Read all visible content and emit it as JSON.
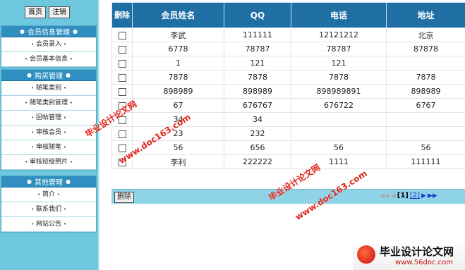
{
  "sidebar": {
    "top_buttons": [
      "首页",
      "注销"
    ],
    "sections": [
      {
        "title": "会员信息管理",
        "items": [
          "会员录入",
          "会员基本信息"
        ]
      },
      {
        "title": "购买管理",
        "items": [
          "随笔类别",
          "随笔类别管理",
          "回帖管理",
          "审核会员",
          "审核随笔",
          "审核班级照片"
        ]
      },
      {
        "title": "其他管理",
        "items": [
          "简介",
          "联系我们",
          "网站公告"
        ]
      }
    ]
  },
  "table": {
    "headers": [
      "删除",
      "会员姓名",
      "QQ",
      "电话",
      "地址"
    ],
    "rows": [
      [
        "李武",
        "111111",
        "12121212",
        "北京"
      ],
      [
        "6778",
        "78787",
        "78787",
        "87878"
      ],
      [
        "1",
        "121",
        "121",
        ""
      ],
      [
        "7878",
        "7878",
        "7878",
        "7878"
      ],
      [
        "898989",
        "898989",
        "898989891",
        "898989"
      ],
      [
        "67",
        "676767",
        "676722",
        "6767"
      ],
      [
        "34",
        "34",
        "",
        ""
      ],
      [
        "23",
        "232",
        "",
        ""
      ],
      [
        "56",
        "656",
        "56",
        "56"
      ],
      [
        "李利",
        "222222",
        "1111",
        "111111"
      ]
    ]
  },
  "footer": {
    "delete_label": "删除",
    "pager": {
      "current": "[1]",
      "next": "[2]"
    }
  },
  "watermark": {
    "text1": "毕业设计论文网",
    "text2": "www.doc163.com",
    "logo_title": "毕业设计论文网",
    "logo_url": "www.56doc.com"
  }
}
